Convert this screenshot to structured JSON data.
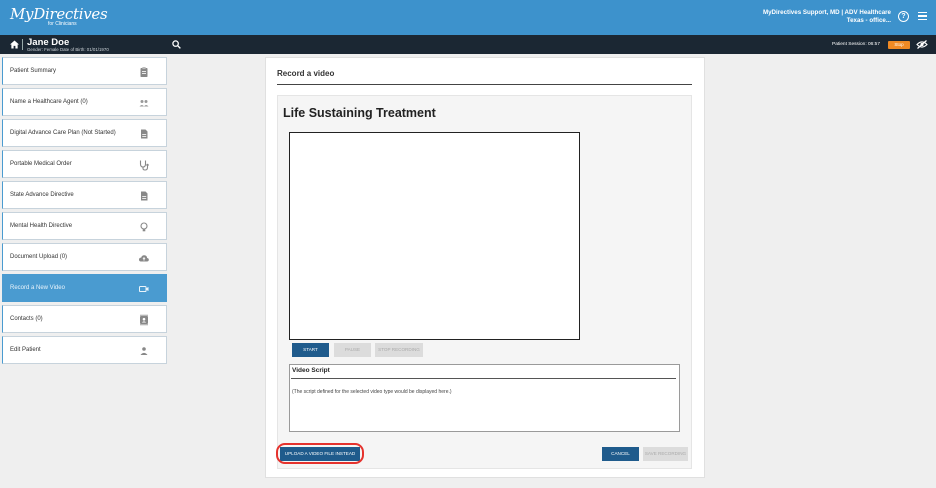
{
  "app": {
    "logo": "MyDirectives",
    "logo_subtitle": "for Clinicians",
    "user_line1": "MyDirectives Support, MD | ADV Healthcare",
    "user_line2": "Texas - office..."
  },
  "patient": {
    "name": "Jane Doe",
    "details": "Gender: Female   Date of Birth: 01/01/1970",
    "session_label": "Patient Session: 06:57",
    "stop_label": "Stop"
  },
  "sidebar": {
    "items": [
      {
        "label": "Patient Summary",
        "icon": "clipboard-icon"
      },
      {
        "label": "Name a Healthcare Agent (0)",
        "icon": "people-icon"
      },
      {
        "label": "Digital Advance Care Plan (Not Started)",
        "icon": "document-icon"
      },
      {
        "label": "Portable Medical Order",
        "icon": "stethoscope-icon"
      },
      {
        "label": "State Advance Directive",
        "icon": "document-icon"
      },
      {
        "label": "Mental Health Directive",
        "icon": "lightbulb-icon"
      },
      {
        "label": "Document Upload (0)",
        "icon": "cloud-upload-icon"
      },
      {
        "label": "Record a New Video",
        "icon": "video-camera-icon",
        "active": true
      },
      {
        "label": "Contacts (0)",
        "icon": "contacts-icon"
      },
      {
        "label": "Edit Patient",
        "icon": "person-icon"
      }
    ]
  },
  "main": {
    "title": "Record a video",
    "card_title": "Life Sustaining Treatment",
    "buttons": {
      "start": "START",
      "pause": "PAUSE",
      "stop_recording": "STOP RECORDING",
      "upload": "UPLOAD A VIDEO FILE INSTEAD",
      "cancel": "CANCEL",
      "save_recording": "SAVE RECORDING"
    },
    "script": {
      "title": "Video Script",
      "placeholder": "(The script defined for the selected video type would be displayed here.)"
    }
  },
  "colors": {
    "topbar": "#3d92cc",
    "patientbar": "#1b2733",
    "accent": "#4a9bd0",
    "primary_button": "#1f5b8c",
    "stop_button": "#f08a24",
    "highlight": "#e5322d"
  }
}
